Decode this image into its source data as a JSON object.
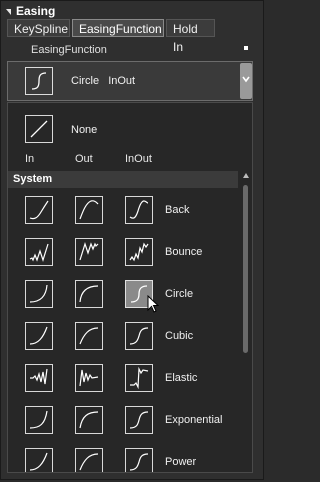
{
  "section": {
    "title": "Easing"
  },
  "tabs": [
    {
      "label": "KeySpline"
    },
    {
      "label": "EasingFunction"
    },
    {
      "label": "Hold In"
    }
  ],
  "function_label": "EasingFunction",
  "selected": {
    "name": "Circle",
    "mode": "InOut",
    "icon": "circle-curve-icon"
  },
  "dropdown": {
    "none_label": "None",
    "column_headers": [
      "In",
      "Out",
      "InOut"
    ],
    "group_label": "System",
    "items": [
      {
        "label": "Back"
      },
      {
        "label": "Bounce"
      },
      {
        "label": "Circle"
      },
      {
        "label": "Cubic"
      },
      {
        "label": "Elastic"
      },
      {
        "label": "Exponential"
      },
      {
        "label": "Power"
      }
    ]
  },
  "colors": {
    "background": "#2f2f2f",
    "dropdown_bg": "#272727",
    "highlight": "#8a8a8a",
    "text": "#ffffff"
  }
}
